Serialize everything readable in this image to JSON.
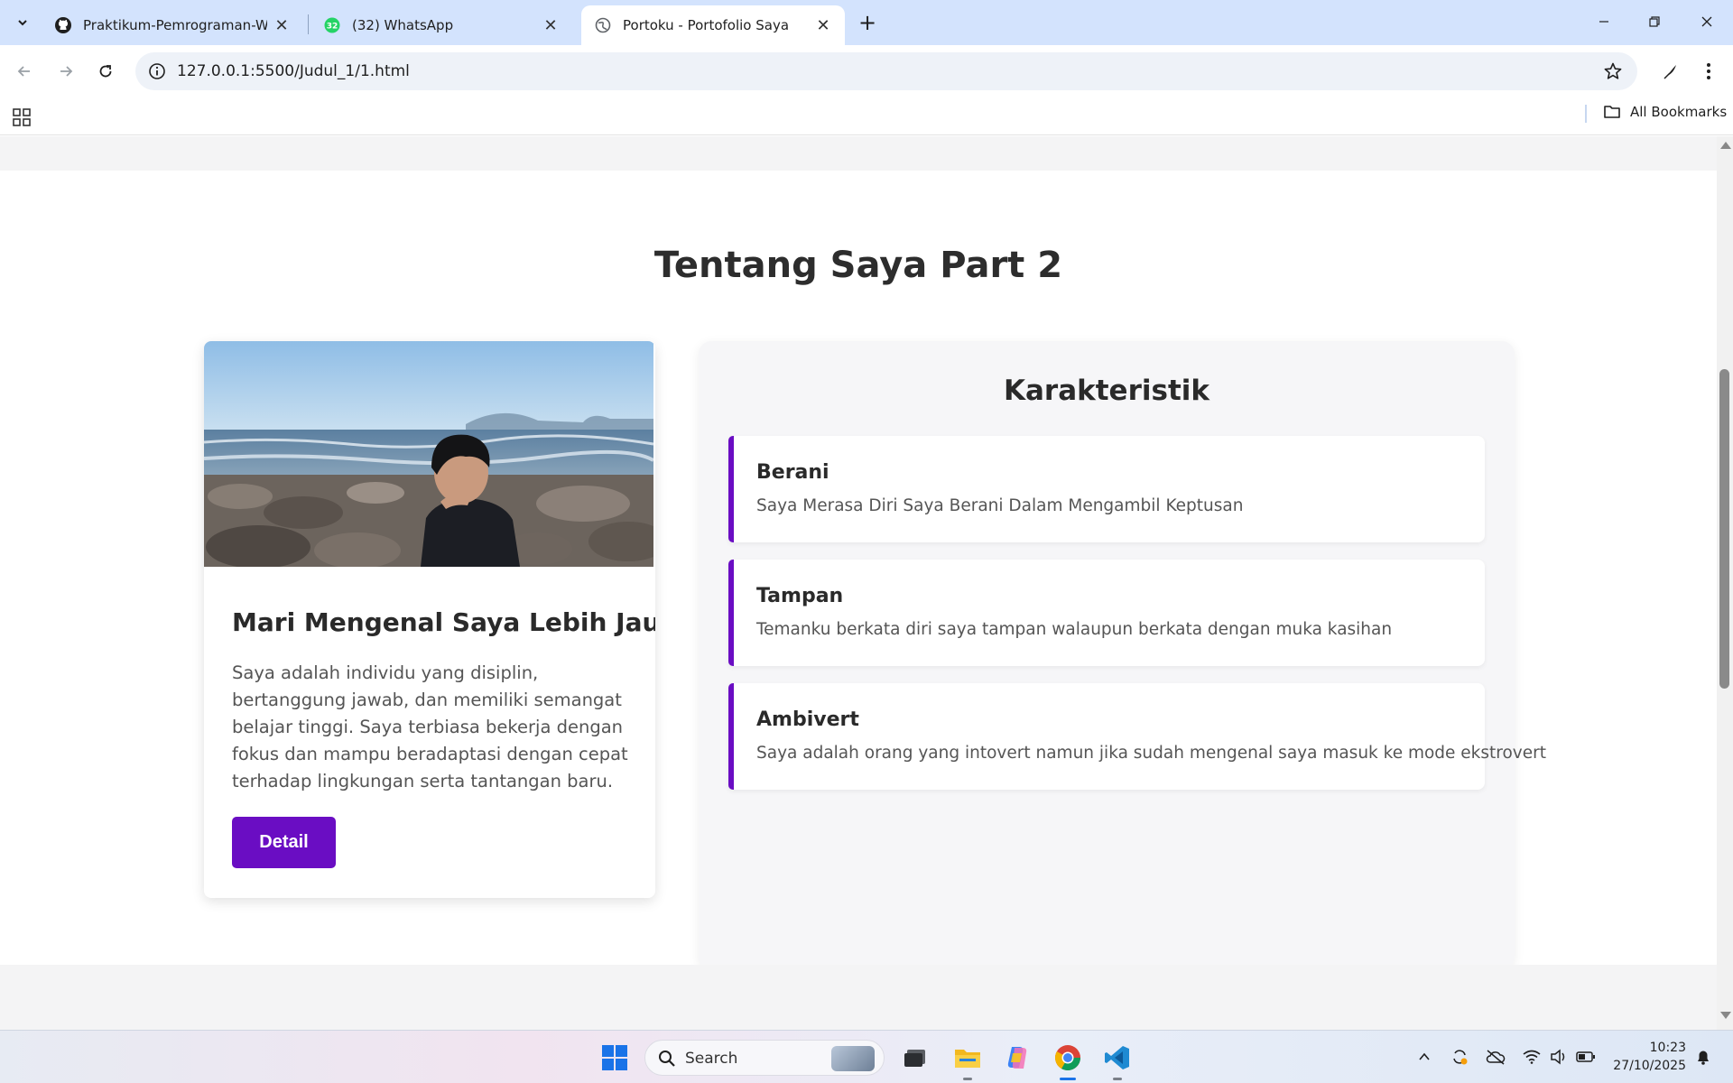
{
  "browser": {
    "tabs": [
      {
        "title": "Praktikum-Pemrograman-Web/",
        "icon": "github-icon"
      },
      {
        "title": "(32) WhatsApp",
        "badge": "32",
        "icon": "whatsapp-icon"
      },
      {
        "title": "Portoku - Portofolio Saya",
        "icon": "globe-icon",
        "active": true
      }
    ],
    "url": "127.0.0.1:5500/Judul_1/1.html",
    "bookmarks_label": "All Bookmarks"
  },
  "page": {
    "section_title": "Tentang Saya Part 2",
    "card": {
      "heading": "Mari Mengenal Saya Lebih Jauh",
      "text": "Saya adalah individu yang disiplin, bertanggung jawab, dan memiliki semangat belajar tinggi. Saya terbiasa bekerja dengan fokus dan mampu beradaptasi dengan cepat terhadap lingkungan serta tantangan baru.",
      "button": "Detail"
    },
    "traits": {
      "title": "Karakteristik",
      "items": [
        {
          "name": "Berani",
          "desc": "Saya Merasa Diri Saya Berani Dalam Mengambil Keptusan"
        },
        {
          "name": "Tampan",
          "desc": "Temanku berkata diri saya tampan walaupun berkata dengan muka kasihan"
        },
        {
          "name": "Ambivert",
          "desc": "Saya adalah orang yang intovert namun jika sudah mengenal saya masuk ke mode ekstrovert"
        }
      ]
    },
    "accent_color": "#6a0dc3"
  },
  "taskbar": {
    "search_label": "Search",
    "time": "10:23",
    "date": "27/10/2025"
  }
}
